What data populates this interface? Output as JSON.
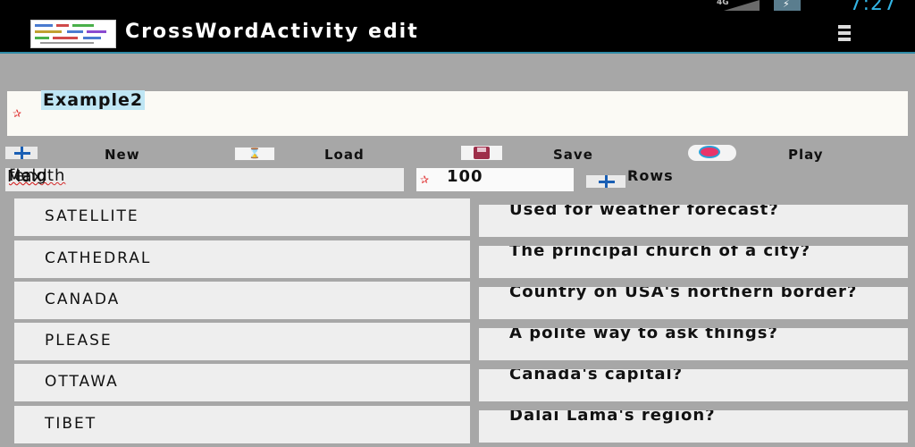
{
  "status_bar": {
    "network": "4G",
    "time": "7:27"
  },
  "action_bar": {
    "title": "CrossWordActivity edit"
  },
  "puzzle_name": {
    "value": "Example2"
  },
  "toolbar": {
    "new_label": "New",
    "load_label": "Load",
    "save_label": "Save",
    "play_label": "Play"
  },
  "settings": {
    "max_field_label": "Max field length",
    "max_field_value": "100",
    "rows_label": "Rows"
  },
  "rows": [
    {
      "word": "SATELLITE",
      "clue": "Used for weather forecast?"
    },
    {
      "word": "CATHEDRAL",
      "clue": "The principal church of a city?"
    },
    {
      "word": "CANADA",
      "clue": "Country on USA's northern border?"
    },
    {
      "word": "PLEASE",
      "clue": "A polite way to ask things?"
    },
    {
      "word": "OTTAWA",
      "clue": "Canada's capital?"
    },
    {
      "word": "TIBET",
      "clue": "Dalai Lama's region?"
    }
  ],
  "colors": {
    "accent": "#33b5e5",
    "action_bar": "#000000",
    "background": "#a7a7a7",
    "cell": "#eeeeee",
    "spell_error": "#d42a2a"
  }
}
